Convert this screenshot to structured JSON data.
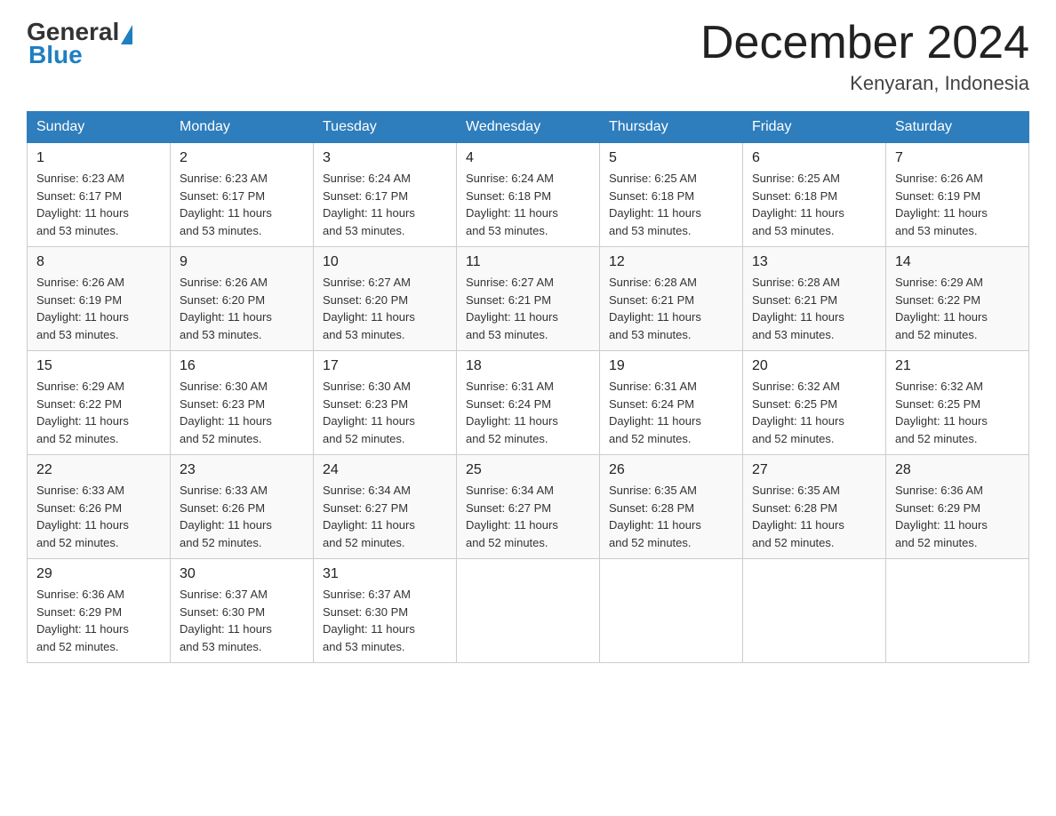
{
  "header": {
    "title": "December 2024",
    "location": "Kenyaran, Indonesia",
    "logo_general": "General",
    "logo_blue": "Blue"
  },
  "calendar": {
    "days_of_week": [
      "Sunday",
      "Monday",
      "Tuesday",
      "Wednesday",
      "Thursday",
      "Friday",
      "Saturday"
    ],
    "weeks": [
      [
        {
          "day": "1",
          "sunrise": "6:23 AM",
          "sunset": "6:17 PM",
          "daylight": "11 hours and 53 minutes."
        },
        {
          "day": "2",
          "sunrise": "6:23 AM",
          "sunset": "6:17 PM",
          "daylight": "11 hours and 53 minutes."
        },
        {
          "day": "3",
          "sunrise": "6:24 AM",
          "sunset": "6:17 PM",
          "daylight": "11 hours and 53 minutes."
        },
        {
          "day": "4",
          "sunrise": "6:24 AM",
          "sunset": "6:18 PM",
          "daylight": "11 hours and 53 minutes."
        },
        {
          "day": "5",
          "sunrise": "6:25 AM",
          "sunset": "6:18 PM",
          "daylight": "11 hours and 53 minutes."
        },
        {
          "day": "6",
          "sunrise": "6:25 AM",
          "sunset": "6:18 PM",
          "daylight": "11 hours and 53 minutes."
        },
        {
          "day": "7",
          "sunrise": "6:26 AM",
          "sunset": "6:19 PM",
          "daylight": "11 hours and 53 minutes."
        }
      ],
      [
        {
          "day": "8",
          "sunrise": "6:26 AM",
          "sunset": "6:19 PM",
          "daylight": "11 hours and 53 minutes."
        },
        {
          "day": "9",
          "sunrise": "6:26 AM",
          "sunset": "6:20 PM",
          "daylight": "11 hours and 53 minutes."
        },
        {
          "day": "10",
          "sunrise": "6:27 AM",
          "sunset": "6:20 PM",
          "daylight": "11 hours and 53 minutes."
        },
        {
          "day": "11",
          "sunrise": "6:27 AM",
          "sunset": "6:21 PM",
          "daylight": "11 hours and 53 minutes."
        },
        {
          "day": "12",
          "sunrise": "6:28 AM",
          "sunset": "6:21 PM",
          "daylight": "11 hours and 53 minutes."
        },
        {
          "day": "13",
          "sunrise": "6:28 AM",
          "sunset": "6:21 PM",
          "daylight": "11 hours and 53 minutes."
        },
        {
          "day": "14",
          "sunrise": "6:29 AM",
          "sunset": "6:22 PM",
          "daylight": "11 hours and 52 minutes."
        }
      ],
      [
        {
          "day": "15",
          "sunrise": "6:29 AM",
          "sunset": "6:22 PM",
          "daylight": "11 hours and 52 minutes."
        },
        {
          "day": "16",
          "sunrise": "6:30 AM",
          "sunset": "6:23 PM",
          "daylight": "11 hours and 52 minutes."
        },
        {
          "day": "17",
          "sunrise": "6:30 AM",
          "sunset": "6:23 PM",
          "daylight": "11 hours and 52 minutes."
        },
        {
          "day": "18",
          "sunrise": "6:31 AM",
          "sunset": "6:24 PM",
          "daylight": "11 hours and 52 minutes."
        },
        {
          "day": "19",
          "sunrise": "6:31 AM",
          "sunset": "6:24 PM",
          "daylight": "11 hours and 52 minutes."
        },
        {
          "day": "20",
          "sunrise": "6:32 AM",
          "sunset": "6:25 PM",
          "daylight": "11 hours and 52 minutes."
        },
        {
          "day": "21",
          "sunrise": "6:32 AM",
          "sunset": "6:25 PM",
          "daylight": "11 hours and 52 minutes."
        }
      ],
      [
        {
          "day": "22",
          "sunrise": "6:33 AM",
          "sunset": "6:26 PM",
          "daylight": "11 hours and 52 minutes."
        },
        {
          "day": "23",
          "sunrise": "6:33 AM",
          "sunset": "6:26 PM",
          "daylight": "11 hours and 52 minutes."
        },
        {
          "day": "24",
          "sunrise": "6:34 AM",
          "sunset": "6:27 PM",
          "daylight": "11 hours and 52 minutes."
        },
        {
          "day": "25",
          "sunrise": "6:34 AM",
          "sunset": "6:27 PM",
          "daylight": "11 hours and 52 minutes."
        },
        {
          "day": "26",
          "sunrise": "6:35 AM",
          "sunset": "6:28 PM",
          "daylight": "11 hours and 52 minutes."
        },
        {
          "day": "27",
          "sunrise": "6:35 AM",
          "sunset": "6:28 PM",
          "daylight": "11 hours and 52 minutes."
        },
        {
          "day": "28",
          "sunrise": "6:36 AM",
          "sunset": "6:29 PM",
          "daylight": "11 hours and 52 minutes."
        }
      ],
      [
        {
          "day": "29",
          "sunrise": "6:36 AM",
          "sunset": "6:29 PM",
          "daylight": "11 hours and 52 minutes."
        },
        {
          "day": "30",
          "sunrise": "6:37 AM",
          "sunset": "6:30 PM",
          "daylight": "11 hours and 53 minutes."
        },
        {
          "day": "31",
          "sunrise": "6:37 AM",
          "sunset": "6:30 PM",
          "daylight": "11 hours and 53 minutes."
        },
        null,
        null,
        null,
        null
      ]
    ],
    "labels": {
      "sunrise": "Sunrise:",
      "sunset": "Sunset:",
      "daylight": "Daylight:"
    }
  }
}
